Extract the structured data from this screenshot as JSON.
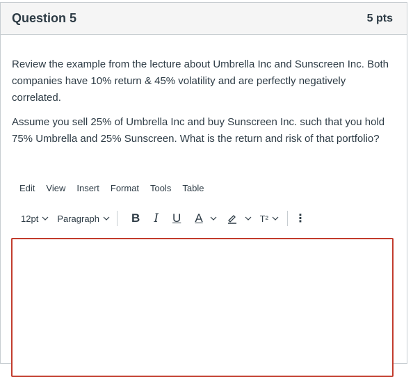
{
  "question": {
    "title": "Question 5",
    "points": "5 pts",
    "paragraph1": "Review the example from the lecture about Umbrella Inc and Sunscreen Inc. Both companies have 10% return & 45% volatility and are perfectly negatively correlated.",
    "paragraph2": "Assume you sell 25% of Umbrella Inc and buy Sunscreen Inc. such that you hold 75% Umbrella and 25% Sunscreen. What is the return and risk of that portfolio?"
  },
  "menubar": {
    "edit": "Edit",
    "view": "View",
    "insert": "Insert",
    "format": "Format",
    "tools": "Tools",
    "table": "Table"
  },
  "toolbar": {
    "font_size": "12pt",
    "block_format": "Paragraph",
    "bold": "B",
    "italic": "I",
    "underline": "U",
    "text_color": "A",
    "superscript": "T²",
    "more": "⋮"
  },
  "editor": {
    "value": ""
  },
  "colors": {
    "editor_border": "#c23c2d",
    "text": "#2d3b45",
    "header_bg": "#f5f5f5"
  }
}
